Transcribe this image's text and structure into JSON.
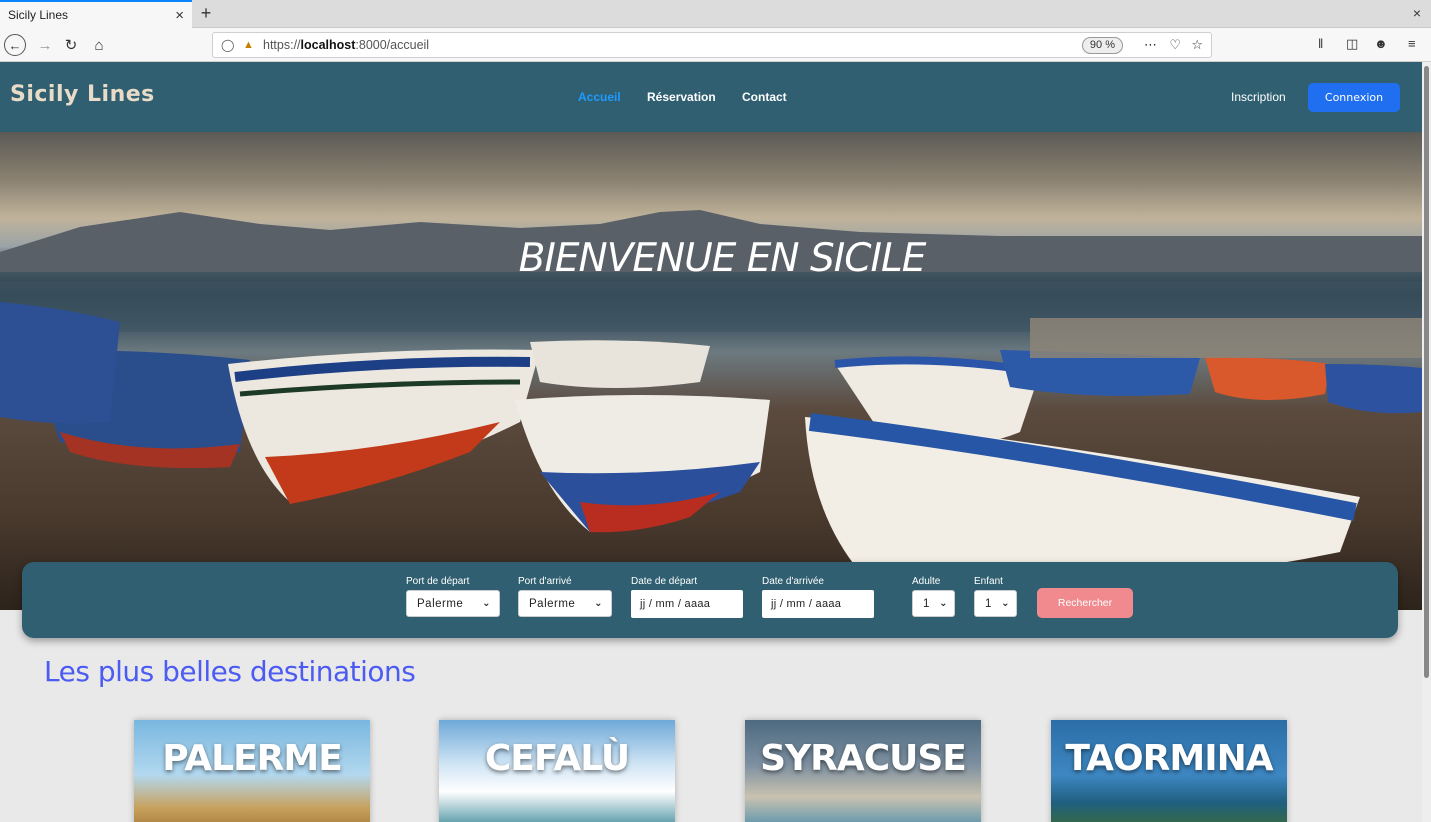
{
  "browser": {
    "tab_title": "Sicily Lines",
    "tab_close": "×",
    "new_tab": "+",
    "window_close": "×",
    "url_prefix": "https://",
    "url_host": "localhost",
    "url_rest": ":8000/accueil",
    "zoom": "90 %",
    "icons": [
      "back-icon",
      "forward-icon",
      "reload-icon",
      "home-icon",
      "shield-icon",
      "lock-icon",
      "more-icon",
      "pocket-icon",
      "bookmark-star-icon",
      "library-icon",
      "sidebar-icon",
      "account-icon",
      "menu-icon"
    ]
  },
  "header": {
    "brand": "Sicily Lines",
    "nav": [
      {
        "label": "Accueil",
        "active": true
      },
      {
        "label": "Réservation",
        "active": false
      },
      {
        "label": "Contact",
        "active": false
      }
    ],
    "inscription": "Inscription",
    "connexion": "Connexion"
  },
  "hero": {
    "title": "BIENVENUE EN SICILE"
  },
  "search": {
    "port_depart_label": "Port de départ",
    "port_depart_value": "Palerme",
    "port_arrive_label": "Port d'arrivé",
    "port_arrive_value": "Palerme",
    "date_depart_label": "Date de départ",
    "date_depart_placeholder": "jj / mm / aaaa",
    "date_arrivee_label": "Date d'arrivée",
    "date_arrivee_placeholder": "jj / mm / aaaa",
    "adulte_label": "Adulte",
    "adulte_value": "1",
    "enfant_label": "Enfant",
    "enfant_value": "1",
    "button": "Rechercher"
  },
  "destinations": {
    "title": "Les plus belles destinations",
    "cards": [
      "PALERME",
      "CEFALÙ",
      "SYRACUSE",
      "TAORMINA"
    ]
  },
  "colors": {
    "header_bg": "#2f5f70",
    "active_link": "#1e9bff",
    "connexion_bg": "#1f6ff0",
    "search_btn": "#f08a8e",
    "section_title": "#4c5cf2"
  }
}
